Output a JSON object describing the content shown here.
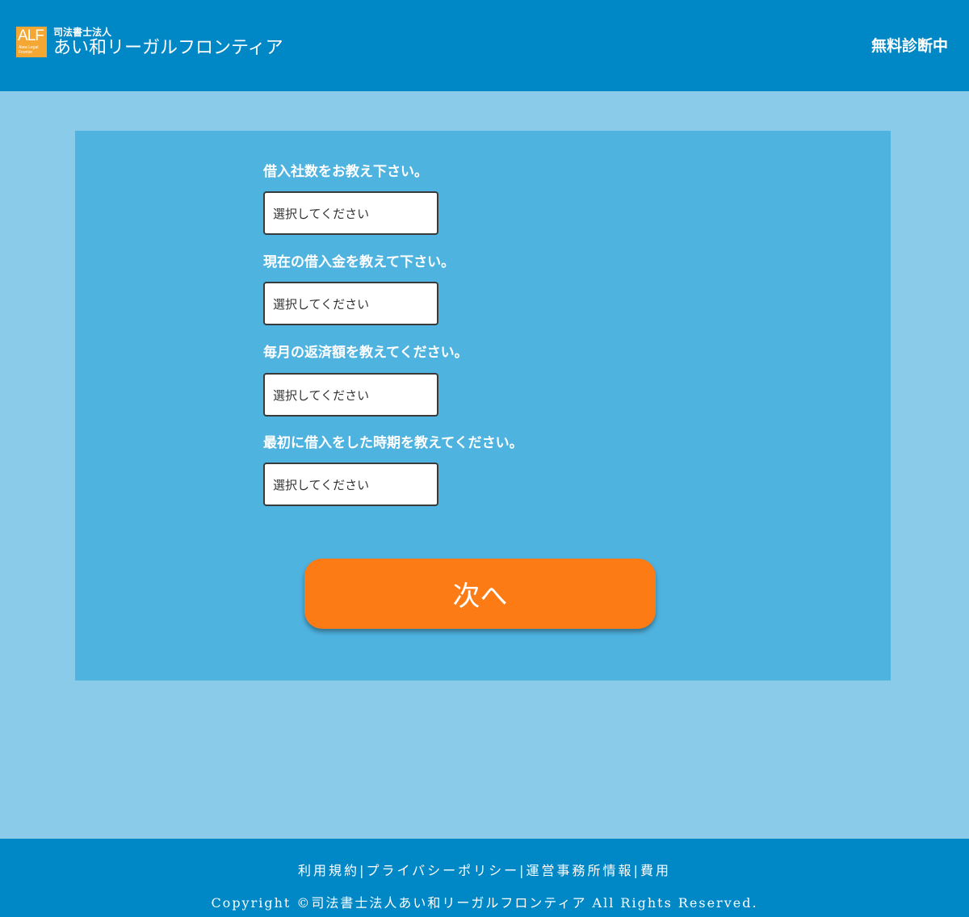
{
  "header": {
    "logo_mark": "ALF",
    "logo_mark_small": "Aiwa Legal Frontier",
    "logo_sub": "司法書士法人",
    "logo_main": "あい和リーガルフロンティア",
    "badge": "無料診断中"
  },
  "form": {
    "questions": [
      {
        "label": "借入社数をお教え下さい。",
        "select_value": "選択してください"
      },
      {
        "label": "現在の借入金を教えて下さい。",
        "select_value": "選択してください"
      },
      {
        "label": "毎月の返済額を教えてください。",
        "select_value": "選択してください"
      },
      {
        "label": "最初に借入をした時期を教えてください。",
        "select_value": "選択してください"
      }
    ],
    "next_label": "次へ"
  },
  "footer": {
    "links": [
      "利用規約",
      "プライバシーポリシー",
      "運営事務所情報",
      "費用"
    ],
    "separator": "|",
    "copyright": "Copyright ©司法書士法人あい和リーガルフロンティア All Rights Reserved."
  },
  "colors": {
    "header_bg": "#0087c6",
    "page_bg": "#8acbe9",
    "panel_bg": "#4fb3e0",
    "button_bg": "#fd7b14",
    "logo_bg": "#f4a733"
  }
}
